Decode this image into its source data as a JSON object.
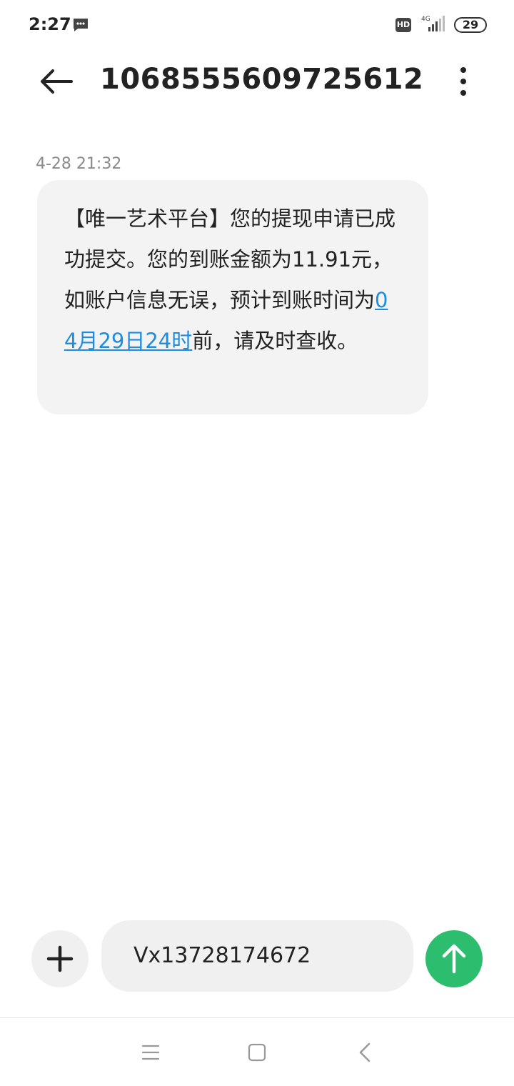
{
  "status_bar": {
    "time": "2:27",
    "hd_label": "HD",
    "network_label": "4G",
    "battery_level": "29"
  },
  "header": {
    "title": "1068555609725612"
  },
  "conversation": {
    "messages": [
      {
        "timestamp": "4-28 21:32",
        "text_before_link": "【唯一艺术平台】您的提现申请已成功提交。您的到账金额为11.91元，如账户信息无误，预计到账时间为",
        "link_text": "04月29日24时",
        "text_after_link": "前，请及时查收。"
      }
    ]
  },
  "compose": {
    "input_value": "Vx13728174672"
  },
  "icons": {
    "back": "arrow-left-icon",
    "more": "more-vertical-icon",
    "add": "plus-icon",
    "send": "arrow-up-icon",
    "nav_menu": "menu-icon",
    "nav_home": "square-home-icon",
    "nav_back": "chevron-left-icon"
  },
  "colors": {
    "send_button": "#2dbd6e",
    "link": "#1f8ce0",
    "bubble": "#f3f3f3"
  }
}
